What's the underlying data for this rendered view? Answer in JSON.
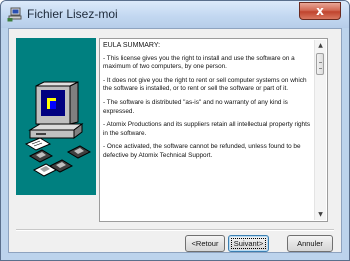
{
  "window": {
    "title": "Fichier Lisez-moi",
    "close_symbol": "x"
  },
  "eula": {
    "heading": "EULA SUMMARY:",
    "paragraphs": [
      "- This license gives you the right to install and use the software on a maximum of two computers, by one person.",
      "- It does not give you the right to rent or sell computer systems on which the software is installed, or to rent or sell the software or part of it.",
      "- The software is distributed \"as-is\" and no warranty of any kind is expressed.",
      "- Atomix Productions and its suppliers retain all intellectual property rights in the software.",
      "- Once activated, the software cannot be refunded, unless found to be defective by Atomix Technical Support."
    ]
  },
  "buttons": {
    "back": "<Retour",
    "next": "Suivant>",
    "cancel": "Annuler"
  },
  "colors": {
    "illustration_bg": "#008080",
    "close_button": "#c8513a"
  }
}
